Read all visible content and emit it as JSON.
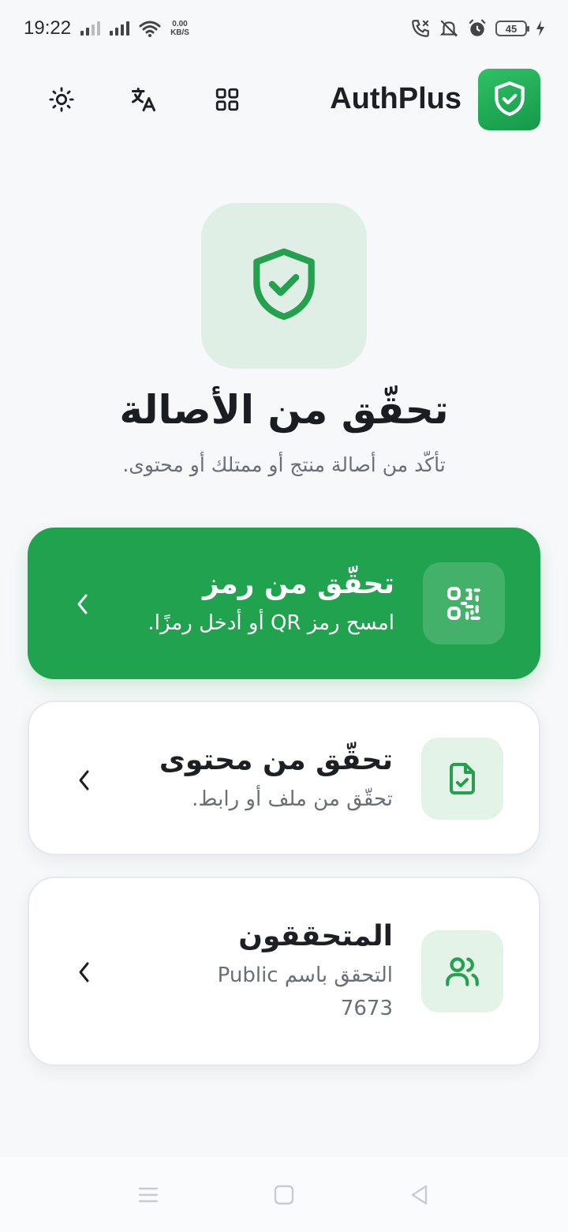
{
  "status_bar": {
    "time": "19:22",
    "net_speed_value": "0.00",
    "net_speed_unit": "KB/S",
    "battery": "45"
  },
  "header": {
    "app_name": "AuthPlus",
    "icons": [
      "sun-icon",
      "translate-icon",
      "grid-icon",
      "shield-check-icon"
    ]
  },
  "hero": {
    "title": "تحقّق من الأصالة",
    "subtitle": "تأكّد من أصالة منتج أو ممتلك أو محتوى."
  },
  "cards": [
    {
      "title": "تحقّق من رمز",
      "subtitle": "امسح رمز QR أو أدخل رمزًا.",
      "icon": "qr-code-icon"
    },
    {
      "title": "تحقّق من محتوى",
      "subtitle": "تحقّق من ملف أو رابط.",
      "icon": "file-check-icon"
    },
    {
      "title": "المتحققون",
      "subtitle_line1": "التحقق باسم Public",
      "subtitle_line2": "7673",
      "icon": "users-icon"
    }
  ],
  "colors": {
    "brand_green": "#21a24e",
    "hero_bg": "#e0efe6",
    "card_icon_bg": "#e3f3e8"
  }
}
